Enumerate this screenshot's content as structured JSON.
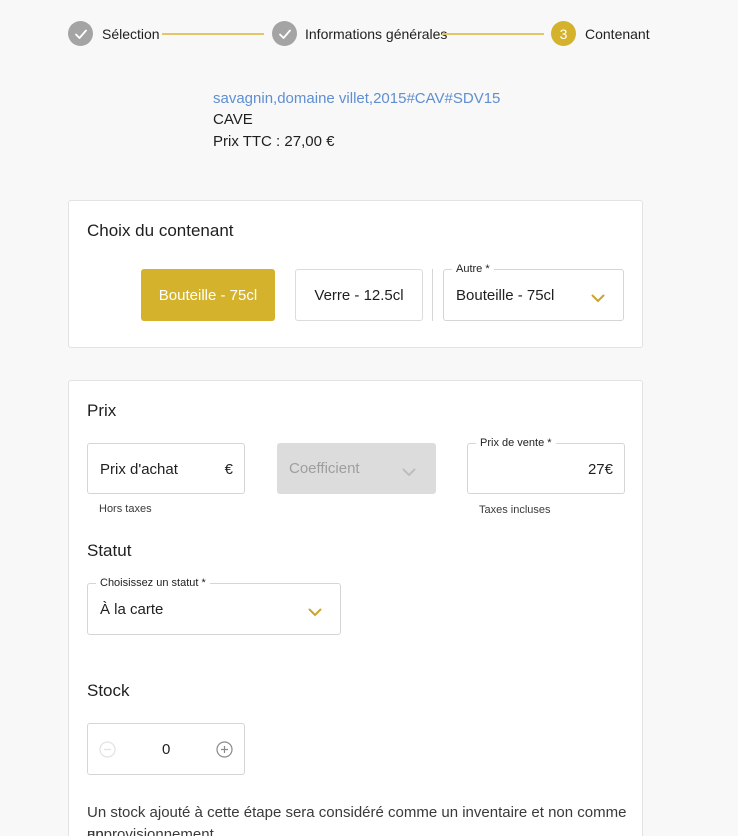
{
  "stepper": {
    "steps": [
      {
        "label": "Sélection",
        "state": "done"
      },
      {
        "label": "Informations générales",
        "state": "done"
      },
      {
        "label": "Contenant",
        "state": "active",
        "number": "3"
      }
    ],
    "accent_color": "#d4b22c",
    "done_color": "#a4a4a4"
  },
  "product": {
    "name": "savagnin,domaine villet,2015#CAV#SDV15",
    "category": "CAVE",
    "price": "Prix TTC : 27,00 €"
  },
  "container_card": {
    "title": "Choix du contenant",
    "options": [
      {
        "label": "Bouteille - 75cl",
        "selected": true
      },
      {
        "label": "Verre - 12.5cl",
        "selected": false
      }
    ],
    "other_select": {
      "label": "Autre *",
      "value": "Bouteille - 75cl"
    }
  },
  "price_card": {
    "title": "Prix",
    "purchase_price": {
      "placeholder": "Prix d'achat",
      "suffix": "€",
      "helper": "Hors taxes"
    },
    "coefficient": {
      "placeholder": "Coefficient",
      "disabled": true
    },
    "sale_price": {
      "label": "Prix de vente *",
      "value": "27€",
      "helper": "Taxes incluses"
    },
    "status_title": "Statut",
    "status_select": {
      "label": "Choisissez un statut *",
      "value": "À la carte"
    },
    "stock_title": "Stock",
    "stock_value": "0",
    "stock_note_line1": "Un stock ajouté à cette étape sera considéré comme un inventaire et non comme un",
    "stock_note_line2": "approvisionnement."
  }
}
